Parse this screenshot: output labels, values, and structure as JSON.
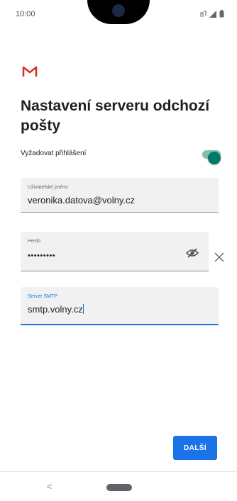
{
  "status_bar": {
    "time": "10:00",
    "icons": [
      "nfc-icon",
      "signal-icon",
      "battery-icon"
    ]
  },
  "app": {
    "logo": "gmail-logo",
    "brand_color": "#d93025",
    "accent_color": "#1a73e8",
    "toggle_color": "#00796b"
  },
  "page": {
    "title": "Nastavení serveru odchozí pošty"
  },
  "auth_toggle": {
    "label": "Vyžadovat přihlášení",
    "checked": true
  },
  "fields": {
    "username": {
      "label": "Uživatelské jméno",
      "value": "veronika.datova@volny.cz"
    },
    "password": {
      "label": "Heslo",
      "value": "•••••••••"
    },
    "smtp": {
      "label": "Server SMTP",
      "value": "smtp.volny.cz"
    }
  },
  "buttons": {
    "next_label": "DALŠÍ"
  },
  "nav": {
    "back_glyph": "<"
  }
}
